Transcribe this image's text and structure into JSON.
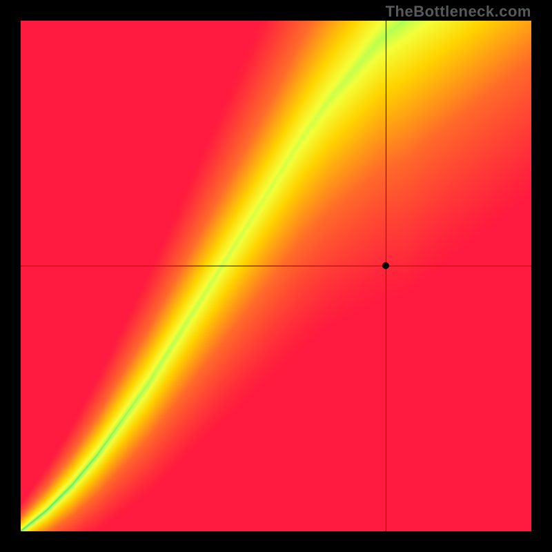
{
  "watermark": "TheBottleneck.com",
  "chart_data": {
    "type": "heatmap",
    "title": "",
    "xlabel": "",
    "ylabel": "",
    "xlim": [
      0,
      1
    ],
    "ylim": [
      0,
      1
    ],
    "crosshair": {
      "x": 0.715,
      "y": 0.52
    },
    "marker": {
      "x": 0.715,
      "y": 0.52
    },
    "ridge_curve": [
      {
        "x": 0.0,
        "y": 0.0
      },
      {
        "x": 0.05,
        "y": 0.04
      },
      {
        "x": 0.1,
        "y": 0.09
      },
      {
        "x": 0.15,
        "y": 0.15
      },
      {
        "x": 0.2,
        "y": 0.22
      },
      {
        "x": 0.25,
        "y": 0.29
      },
      {
        "x": 0.3,
        "y": 0.37
      },
      {
        "x": 0.35,
        "y": 0.45
      },
      {
        "x": 0.4,
        "y": 0.53
      },
      {
        "x": 0.45,
        "y": 0.61
      },
      {
        "x": 0.5,
        "y": 0.69
      },
      {
        "x": 0.55,
        "y": 0.77
      },
      {
        "x": 0.6,
        "y": 0.84
      },
      {
        "x": 0.65,
        "y": 0.9
      },
      {
        "x": 0.7,
        "y": 0.96
      },
      {
        "x": 0.75,
        "y": 1.0
      }
    ],
    "ridge_half_width_bottom": 0.01,
    "ridge_half_width_top": 0.1,
    "color_scale": [
      {
        "t": 0.0,
        "color": "#ff1a3f"
      },
      {
        "t": 0.4,
        "color": "#ff6a2a"
      },
      {
        "t": 0.7,
        "color": "#ffd400"
      },
      {
        "t": 0.86,
        "color": "#f4ff3a"
      },
      {
        "t": 0.93,
        "color": "#b8ff50"
      },
      {
        "t": 1.0,
        "color": "#00d88a"
      }
    ]
  }
}
